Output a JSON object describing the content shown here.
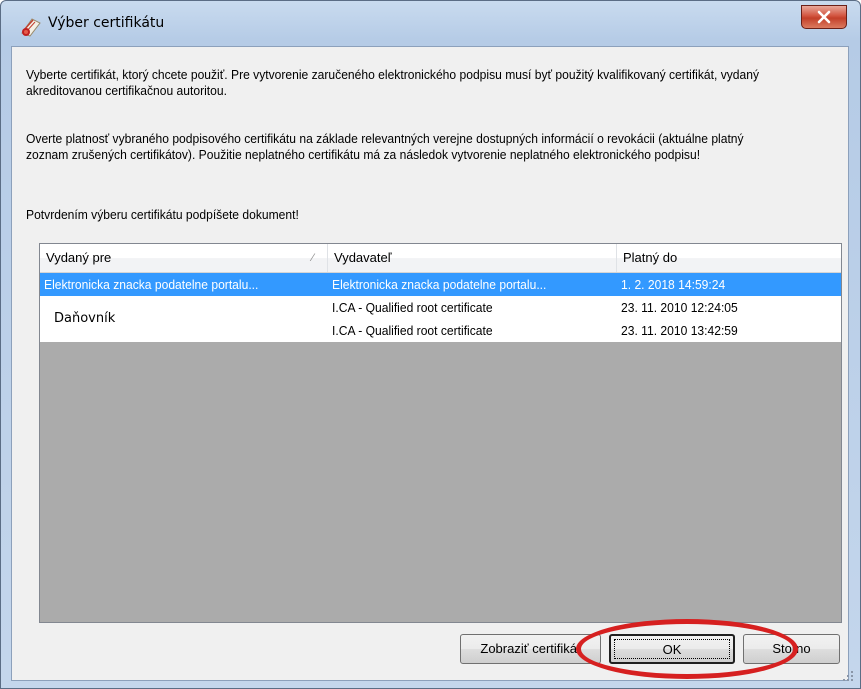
{
  "window": {
    "title": "Výber certifikátu"
  },
  "info": {
    "paragraph1": "Vyberte certifikát, ktorý chcete použiť. Pre vytvorenie zaručeného elektronického podpisu musí byť použitý kvalifikovaný certifikát, vydaný akreditovanou certifikačnou autoritou.",
    "paragraph2": "Overte platnosť vybraného podpisového certifikátu na základe relevantných verejne dostupných informácií o revokácii (aktuálne platný zoznam zrušených certifikátov). Použitie neplatného certifikátu má za následok vytvorenie neplatného elektronického podpisu!",
    "paragraph3": "Potvrdením výberu certifikátu podpíšete dokument!"
  },
  "list": {
    "columns": [
      "Vydaný pre",
      "Vydavateľ",
      "Platný do"
    ],
    "rows": [
      {
        "issued_to": "Elektronicka znacka podatelne portalu...",
        "issuer": "Elektronicka znacka podatelne portalu...",
        "valid_until": "1. 2. 2018 14:59:24",
        "selected": true
      },
      {
        "issued_to": "",
        "issuer": "I.CA - Qualified root certificate",
        "valid_until": "23. 11. 2010 12:24:05",
        "selected": false
      },
      {
        "issued_to": "",
        "issuer": "I.CA - Qualified root certificate",
        "valid_until": "23. 11. 2010 13:42:59",
        "selected": false
      }
    ],
    "group_label": "Daňovník"
  },
  "buttons": {
    "show_certificate": "Zobraziť certifikát",
    "ok": "OK",
    "cancel": "Storno"
  },
  "colors": {
    "selection": "#3399ff",
    "list_background": "#ababab",
    "annotation": "#d62020",
    "close_button": "#c3402a"
  },
  "icons": {
    "app": "certificate-seal-icon",
    "close": "close-icon",
    "sort": "sort-indicator-icon",
    "resize": "resize-grip-icon"
  }
}
